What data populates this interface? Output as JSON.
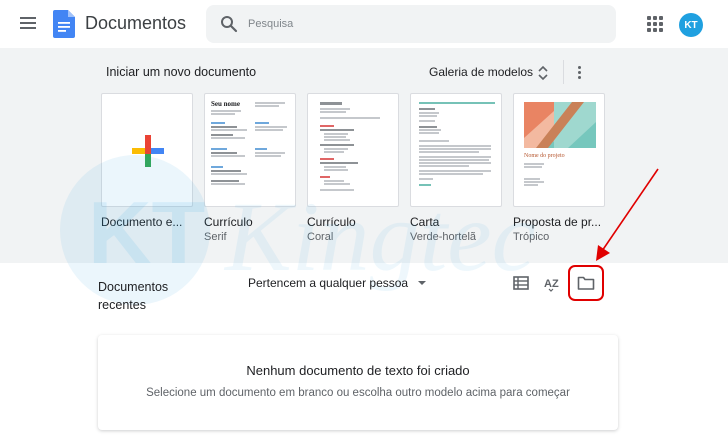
{
  "header": {
    "app_title": "Documentos",
    "search_placeholder": "Pesquisa",
    "avatar_initials": "KT"
  },
  "gallery": {
    "heading": "Iniciar um novo documento",
    "gallery_link": "Galeria de modelos",
    "templates": [
      {
        "name": "Documento e...",
        "subtitle": ""
      },
      {
        "name": "Currículo",
        "subtitle": "Serif"
      },
      {
        "name": "Currículo",
        "subtitle": "Coral"
      },
      {
        "name": "Carta",
        "subtitle": "Verde-hortelã"
      },
      {
        "name": "Proposta de pr...",
        "subtitle": "Trópico"
      }
    ],
    "serif_heading": "Seu nome",
    "proposal_title": "Nome do projeto"
  },
  "recent": {
    "title": "Documentos recentes",
    "owner_filter": "Pertencem a qualquer pessoa",
    "sort_label": "AZ",
    "empty_title": "Nenhum documento de texto foi criado",
    "empty_subtitle": "Selecione um documento em branco ou escolha outro modelo acima para começar"
  },
  "watermark": {
    "text": "Kingtec"
  },
  "colors": {
    "accent_red": "#e00000",
    "gallery_bg": "#f1f3f4",
    "docs_blue": "#4285f4"
  }
}
